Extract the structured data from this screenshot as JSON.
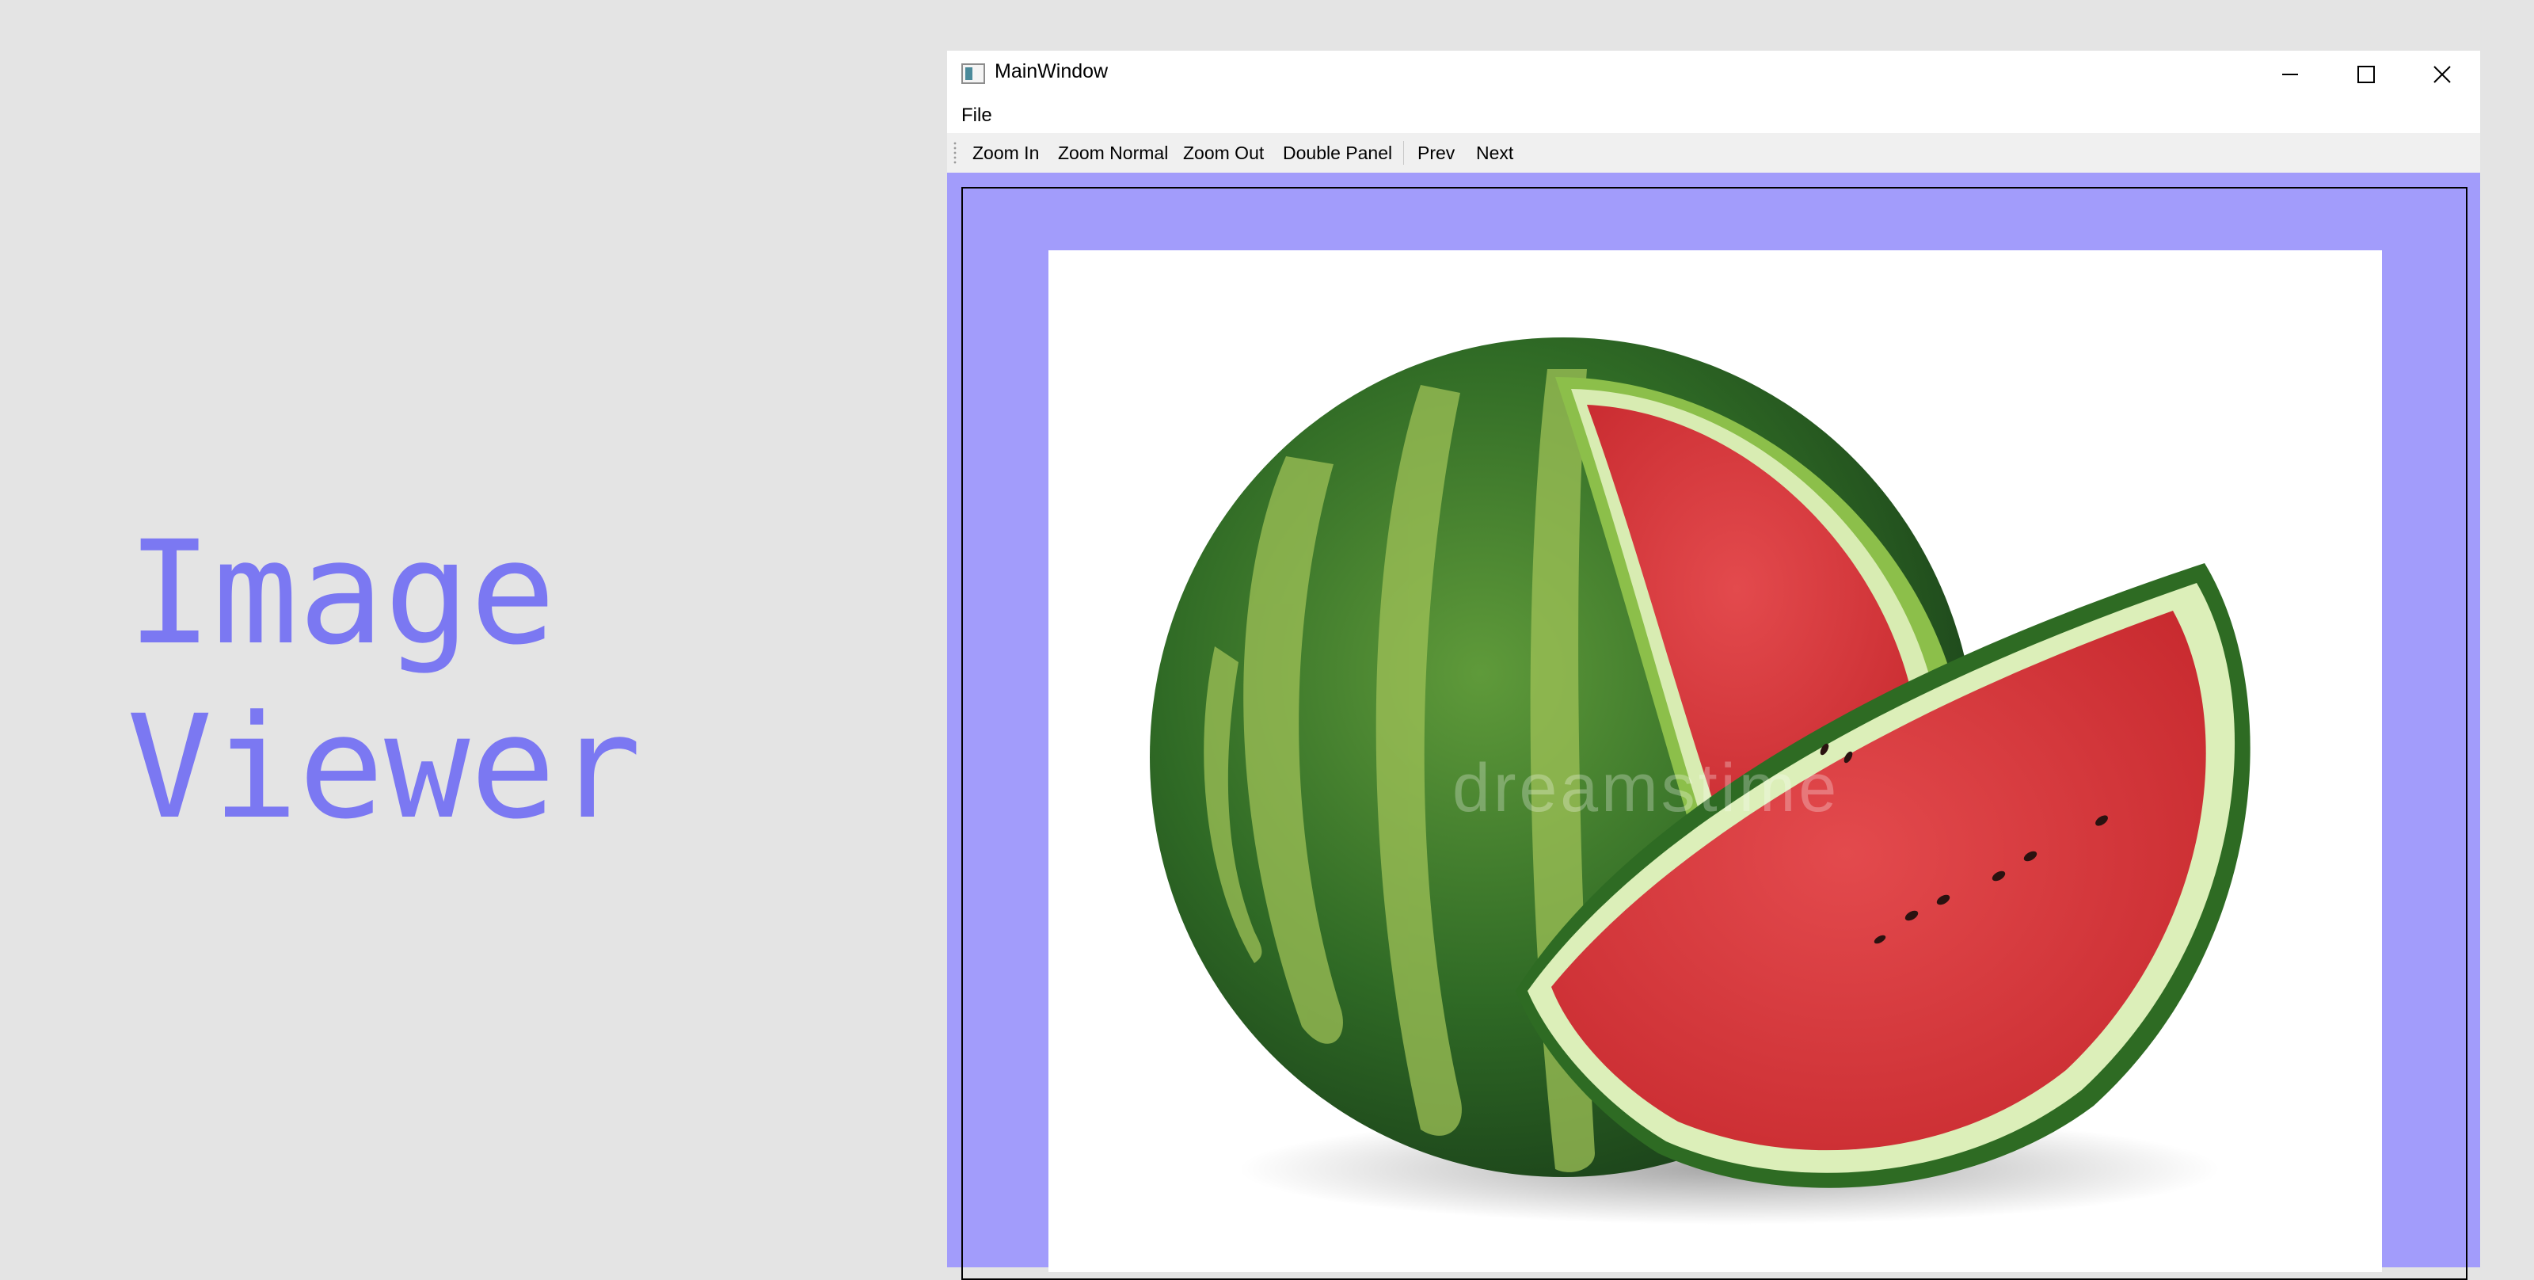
{
  "hero": {
    "line1": "Image",
    "line2": "Viewer"
  },
  "window": {
    "title": "MainWindow",
    "icon": "app-window-icon",
    "controls": {
      "minimize": "minimize-icon",
      "maximize": "maximize-icon",
      "close": "close-icon"
    }
  },
  "menu": {
    "file": "File"
  },
  "toolbar": {
    "zoom_in": "Zoom In",
    "zoom_normal": "Zoom Normal",
    "zoom_out": "Zoom Out",
    "double_panel": "Double Panel",
    "prev": "Prev",
    "next": "Next"
  },
  "image": {
    "subject": "watermelon-photo",
    "watermark": "dreamstime"
  },
  "colors": {
    "background": "#e4e4e4",
    "accent": "#7b78f2",
    "viewport": "#a29cfb"
  }
}
